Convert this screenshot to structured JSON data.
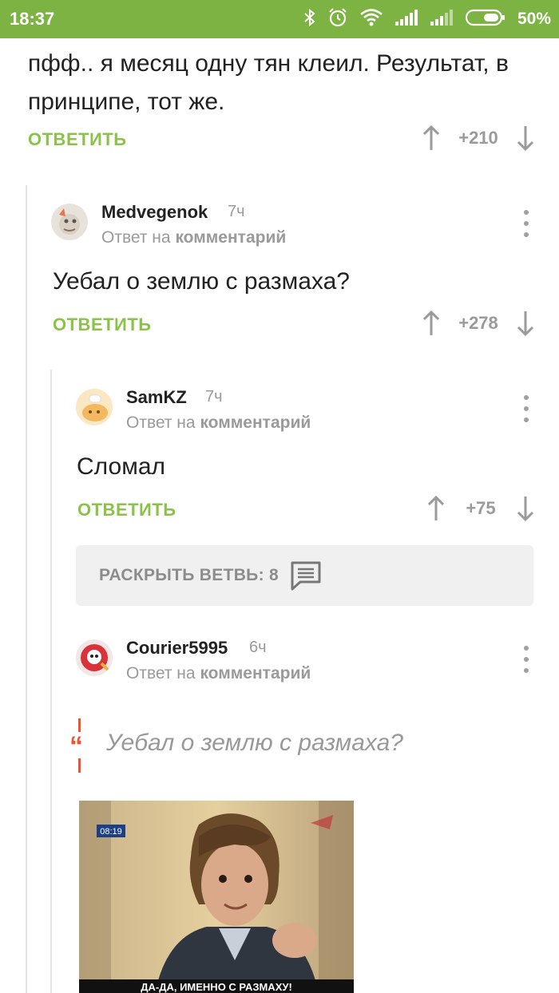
{
  "status_bar": {
    "time": "18:37",
    "battery_percent": "50%",
    "icons": [
      "bluetooth-icon",
      "alarm-icon",
      "wifi-icon",
      "signal-icon",
      "signal-icon",
      "battery-icon"
    ],
    "color": "#7cb342"
  },
  "post": {
    "text": "пфф.. я месяц одну тян клеил. Результат, в принципе, тот же.",
    "reply_label": "ОТВЕТИТЬ",
    "score": "+210"
  },
  "comments": [
    {
      "username": "Medvegenok",
      "time": "7ч",
      "reply_to_prefix": "Ответ на",
      "reply_to_target": "комментарий",
      "text": "Уебал о землю с размаха?",
      "reply_label": "ОТВЕТИТЬ",
      "score": "+278"
    },
    {
      "username": "SamKZ",
      "time": "7ч",
      "reply_to_prefix": "Ответ на",
      "reply_to_target": "комментарий",
      "text": "Сломал",
      "reply_label": "ОТВЕТИТЬ",
      "score": "+75"
    },
    {
      "username": "Courier5995",
      "time": "6ч",
      "reply_to_prefix": "Ответ на",
      "reply_to_target": "комментарий",
      "quote": "Уебал о землю с размаха?",
      "meme": {
        "timestamp": "08:19",
        "caption": "ДА-ДА, ИМЕННО С РАЗМАХУ!"
      }
    }
  ],
  "expand_branch": {
    "label": "РАСКРЫТЬ ВЕТВЬ: 8",
    "icon": "comment-icon"
  },
  "colors": {
    "accent_green": "#8bc34a",
    "quote_red": "#e8563a",
    "muted": "#9a9a9a"
  }
}
